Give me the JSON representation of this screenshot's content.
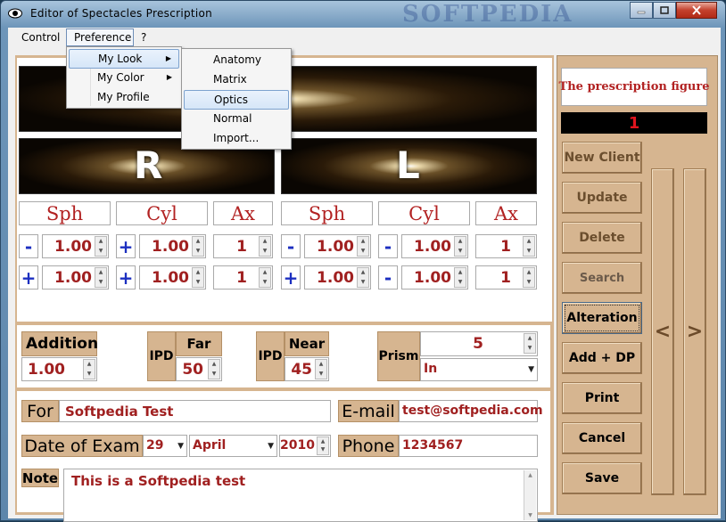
{
  "window": {
    "title": "Editor of  Spectacles  Prescription",
    "watermark": "SOFTPEDIA"
  },
  "menubar": {
    "control": "Control",
    "preference": "Preference",
    "help": "?"
  },
  "preference_menu": {
    "items": [
      {
        "label": "My Look"
      },
      {
        "label": "My Color"
      },
      {
        "label": "My Profile"
      }
    ]
  },
  "look_submenu": {
    "items": [
      {
        "label": "Anatomy"
      },
      {
        "label": "Matrix"
      },
      {
        "label": "Optics"
      },
      {
        "label": "Normal"
      },
      {
        "label": "Import..."
      }
    ]
  },
  "eyes": {
    "right_letter": "R",
    "left_letter": "L",
    "headers": {
      "sph": "Sph",
      "cyl": "Cyl",
      "ax": "Ax"
    },
    "right": {
      "row1": {
        "sph_sign": "-",
        "sph": "1.00",
        "cyl_sign": "+",
        "cyl": "1.00",
        "ax": "1"
      },
      "row2": {
        "sph_sign": "+",
        "sph": "1.00",
        "cyl_sign": "+",
        "cyl": "1.00",
        "ax": "1"
      }
    },
    "left": {
      "row1": {
        "sph_sign": "-",
        "sph": "1.00",
        "cyl_sign": "-",
        "cyl": "1.00",
        "ax": "1"
      },
      "row2": {
        "sph_sign": "+",
        "sph": "1.00",
        "cyl_sign": "-",
        "cyl": "1.00",
        "ax": "1"
      }
    }
  },
  "addition": {
    "label": "Addition",
    "value": "1.00"
  },
  "ipd_far": {
    "ipd": "IPD",
    "label": "Far",
    "value": "50"
  },
  "ipd_near": {
    "ipd": "IPD",
    "label": "Near",
    "value": "45"
  },
  "prism": {
    "label": "Prism",
    "value": "5",
    "direction": "In"
  },
  "client": {
    "for_label": "For",
    "for_value": "Softpedia Test",
    "email_label": "E-mail",
    "email_value": "test@softpedia.com",
    "date_label": "Date of Exam",
    "day": "29",
    "month": "April",
    "year": "2010",
    "phone_label": "Phone",
    "phone_value": "1234567",
    "note_label": "Note",
    "note_value": "This is a Softpedia test"
  },
  "side": {
    "figure_title": "The prescription figure",
    "counter": "1",
    "buttons": [
      "New Client",
      "Update",
      "Delete",
      "Search",
      "Alteration",
      "Add + DP",
      "Print",
      "Cancel",
      "Save"
    ],
    "prev": "<",
    "next": ">"
  },
  "colors": {
    "panel": "#d6b590",
    "value_red": "#a02020",
    "sign_blue": "#1c2fc0"
  }
}
